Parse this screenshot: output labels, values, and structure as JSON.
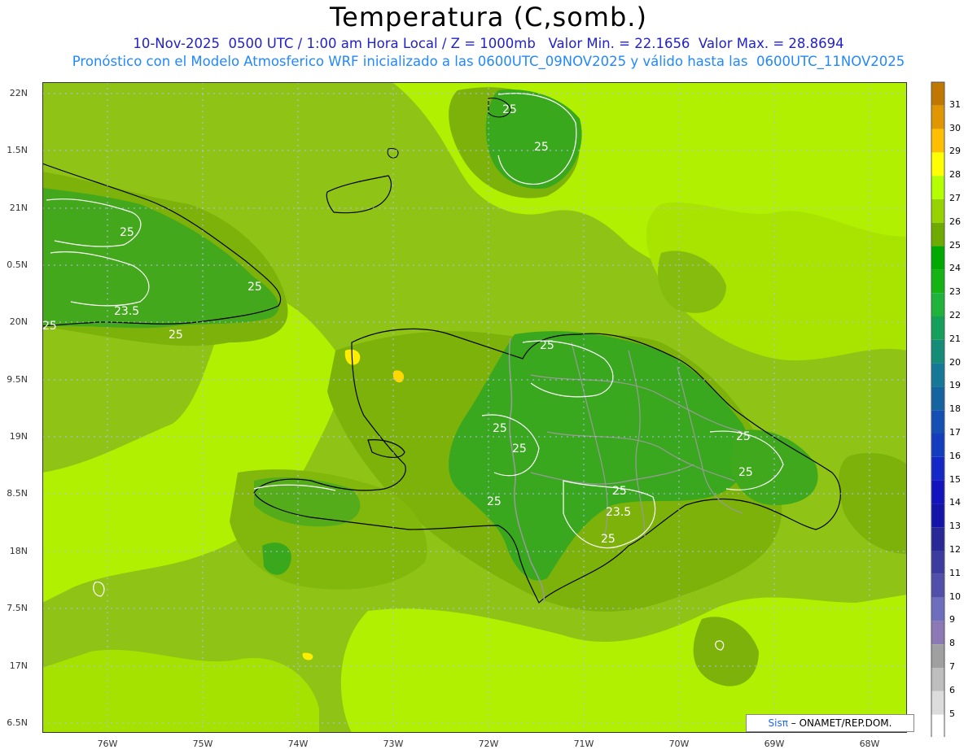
{
  "title": "Temperatura (C,somb.)",
  "subtitle_line1": "10-Nov-2025  0500 UTC / 1:00 am Hora Local / Z = 1000mb   Valor Min. = 22.1656  Valor Max. = 28.8694",
  "subtitle_line2": "Pronóstico con el Modelo Atmosferico WRF inicializado a las 0600UTC_09NOV2025 y válido hasta las  0600UTC_11NOV2025",
  "credit": {
    "logo": "Sisπ",
    "text": "– ONAMET/REP.DOM."
  },
  "axes": {
    "lat_labels": [
      "22N",
      "1.5N",
      "21N",
      "0.5N",
      "20N",
      "9.5N",
      "19N",
      "8.5N",
      "18N",
      "7.5N",
      "17N",
      "6.5N"
    ],
    "lon_labels": [
      "76W",
      "75W",
      "74W",
      "73W",
      "72W",
      "71W",
      "70W",
      "69W",
      "68W"
    ]
  },
  "contour_labels": [
    "25",
    "25",
    "25",
    "25",
    "23.5",
    "25",
    "25",
    "25",
    "25",
    "25",
    "25",
    "25",
    "25",
    "23.5",
    "25",
    "25"
  ],
  "colorbar": {
    "labels": [
      "31",
      "30",
      "29",
      "28",
      "27",
      "26",
      "25",
      "24",
      "23",
      "22",
      "21",
      "20",
      "19",
      "18",
      "17",
      "16",
      "15",
      "14",
      "13",
      "12",
      "11",
      "10",
      "9",
      "8",
      "7",
      "6",
      "5"
    ],
    "colors": [
      "#c07800",
      "#e09600",
      "#ffbe00",
      "#ffff00",
      "#b4ff00",
      "#96d200",
      "#6eaa00",
      "#00aa00",
      "#14b414",
      "#1eb43c",
      "#14a05a",
      "#148c78",
      "#147896",
      "#1464a0",
      "#1450b4",
      "#143cbe",
      "#1428c8",
      "#1414be",
      "#1414aa",
      "#282896",
      "#3c3ca0",
      "#5050aa",
      "#6e6ebe",
      "#8c78b4",
      "#a0a0a0",
      "#bebebe",
      "#dcdcdc",
      "#ffffff"
    ]
  },
  "colors": {
    "base": "#9fcf1a",
    "bright": "#b4ff00",
    "medium": "#83b60b",
    "dark": "#2fa81e",
    "warm": "#ffee00"
  }
}
